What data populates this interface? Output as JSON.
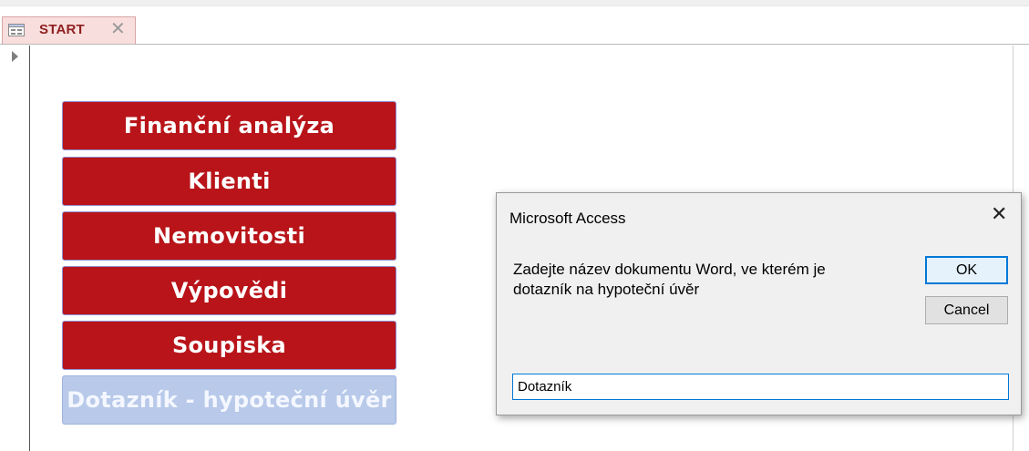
{
  "tab": {
    "label": "START",
    "close": "✕"
  },
  "nav_buttons": [
    {
      "label": "Finanční analýza",
      "enabled": true
    },
    {
      "label": "Klienti",
      "enabled": true
    },
    {
      "label": "Nemovitosti",
      "enabled": true
    },
    {
      "label": "Výpovědi",
      "enabled": true
    },
    {
      "label": "Soupiska",
      "enabled": true
    },
    {
      "label": "Dotazník - hypoteční úvěr",
      "enabled": false
    }
  ],
  "dialog": {
    "title": "Microsoft Access",
    "close": "✕",
    "message_line1": "Zadejte název dokumentu Word, ve kterém je",
    "message_line2": "dotazník na hypoteční úvěr",
    "ok_label": "OK",
    "cancel_label": "Cancel",
    "input_value": "Dotazník"
  },
  "colors": {
    "button": "#b81419",
    "button_disabled": "#b8c9e9",
    "tab_bg": "#f9dede",
    "focus": "#0078d7"
  }
}
